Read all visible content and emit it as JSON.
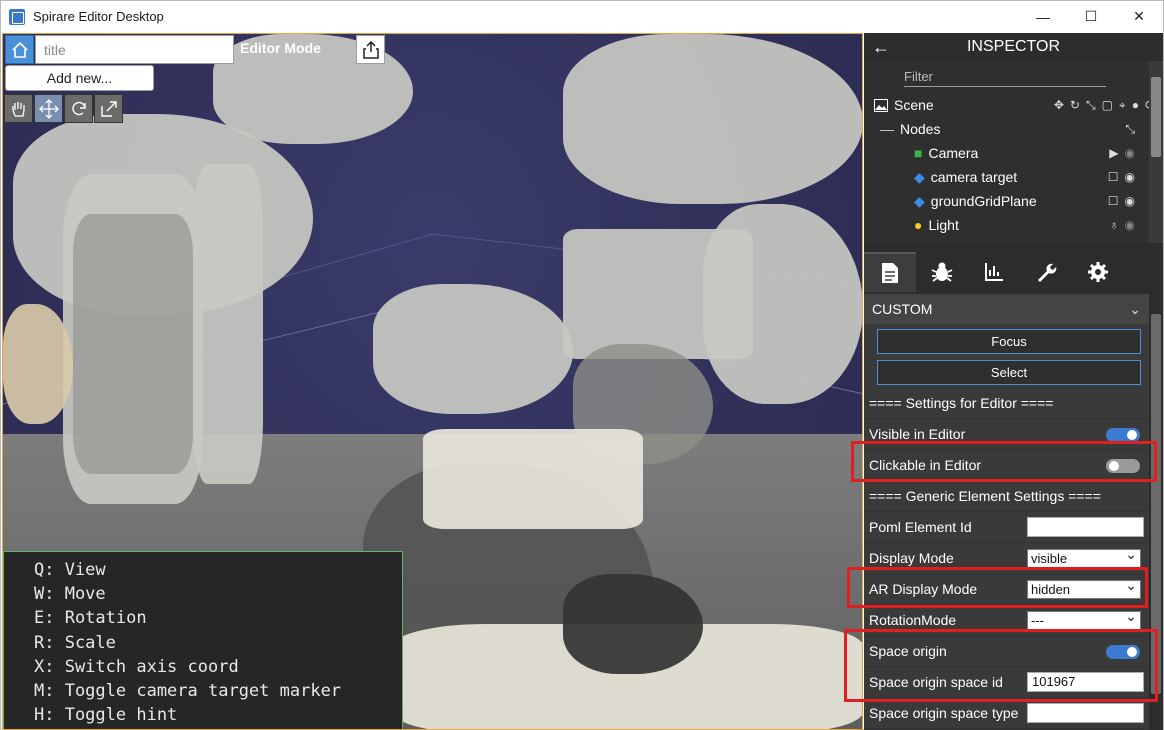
{
  "window": {
    "title": "Spirare Editor Desktop",
    "controls": [
      "—",
      "☐",
      "✕"
    ]
  },
  "toolbar": {
    "title_placeholder": "title",
    "mode_label": "Editor Mode",
    "add_new_label": "Add new..."
  },
  "hint": {
    "lines": [
      "Q: View",
      "W: Move",
      "E: Rotation",
      "R: Scale",
      "X: Switch axis coord",
      "M: Toggle camera target marker",
      "H: Toggle hint"
    ]
  },
  "inspector": {
    "title": "INSPECTOR",
    "filter_placeholder": "Filter",
    "scene_label": "Scene",
    "nodes_label": "Nodes",
    "nodes": [
      {
        "label": "Camera",
        "icon": "camera-icon",
        "icon_color": "#3bb54a"
      },
      {
        "label": "camera target",
        "icon": "cube-icon",
        "icon_color": "#3a8ee6"
      },
      {
        "label": "groundGridPlane",
        "icon": "cube-icon",
        "icon_color": "#3a8ee6"
      },
      {
        "label": "Light",
        "icon": "bulb-icon",
        "icon_color": "#f5d020"
      }
    ],
    "section_label": "CUSTOM",
    "focus_label": "Focus",
    "select_label": "Select",
    "editor_settings_header": "==== Settings for Editor ====",
    "visible_in_editor_label": "Visible in Editor",
    "visible_in_editor": true,
    "clickable_in_editor_label": "Clickable in Editor",
    "clickable_in_editor": false,
    "generic_settings_header": "==== Generic Element Settings ====",
    "poml_element_id_label": "Poml Element Id",
    "poml_element_id": "",
    "display_mode_label": "Display Mode",
    "display_mode": "visible",
    "ar_display_mode_label": "AR Display Mode",
    "ar_display_mode": "hidden",
    "rotation_mode_label": "RotationMode",
    "rotation_mode": "---",
    "space_origin_label": "Space origin",
    "space_origin": true,
    "space_origin_space_id_label": "Space origin space id",
    "space_origin_space_id": "101967",
    "space_origin_space_type_label": "Space origin space type",
    "space_origin_space_type": ""
  },
  "colors": {
    "accent": "#4a90d9",
    "highlight": "#e02020",
    "toggle_on": "#3c7bd0"
  }
}
